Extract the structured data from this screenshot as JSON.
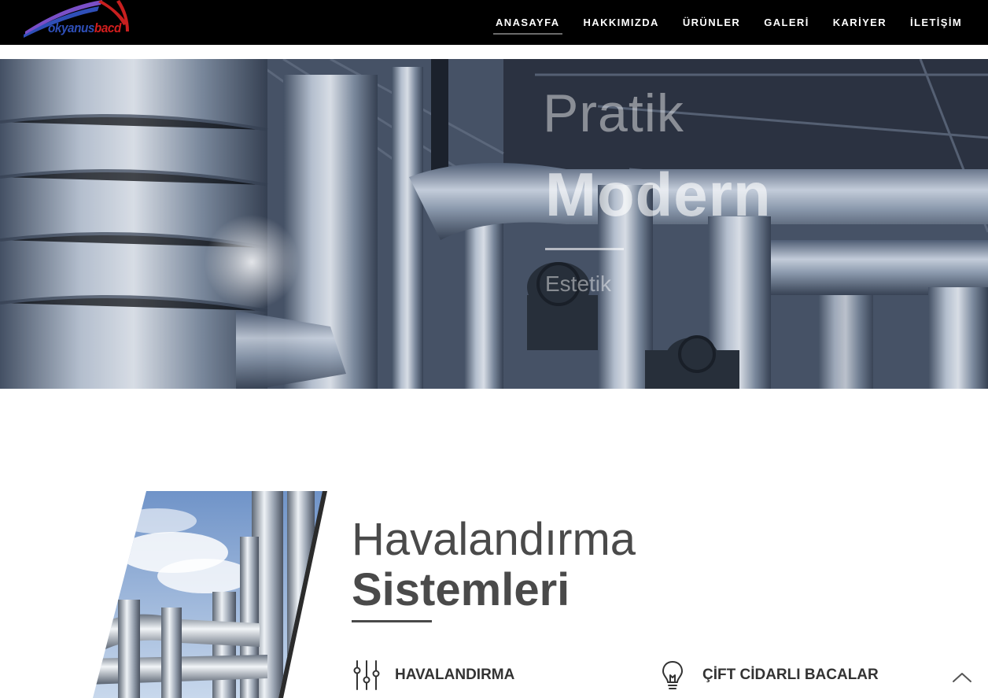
{
  "header": {
    "logo": {
      "text_part1": "okyanus",
      "text_part2": "bacd"
    },
    "nav": [
      {
        "label": "ANASAYFA",
        "active": true
      },
      {
        "label": "HAKKIMIZDA",
        "active": false
      },
      {
        "label": "ÜRÜNLER",
        "active": false
      },
      {
        "label": "GALERİ",
        "active": false
      },
      {
        "label": "KARİYER",
        "active": false
      },
      {
        "label": "İLETİŞİM",
        "active": false
      }
    ]
  },
  "hero": {
    "line1": "Pratik",
    "line2": "Modern",
    "line3": "Estetik"
  },
  "section": {
    "title_light": "Havalandırma",
    "title_bold": "Sistemleri",
    "features": [
      {
        "label": "HAVALANDIRMA",
        "icon": "sliders-icon"
      },
      {
        "label": "ÇİFT CİDARLI BACALAR",
        "icon": "lightbulb-icon"
      }
    ]
  },
  "colors": {
    "header_bg": "#000000",
    "logo_blue": "#2f4fb8",
    "logo_red": "#d21d1d",
    "heading_text": "#4a4a4a"
  },
  "icons": {
    "scroll_top": "chevron-up-icon"
  }
}
